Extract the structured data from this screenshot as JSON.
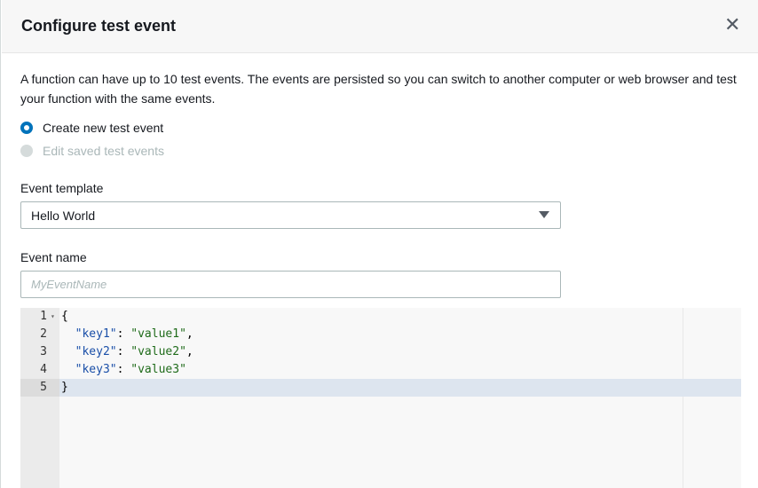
{
  "dialog": {
    "title": "Configure test event",
    "close_icon": "close-icon"
  },
  "description": "A function can have up to 10 test events. The events are persisted so you can switch to another computer or web browser and test your function with the same events.",
  "radios": [
    {
      "label": "Create new test event",
      "selected": true
    },
    {
      "label": "Edit saved test events",
      "selected": false,
      "disabled": true
    }
  ],
  "event_template": {
    "label": "Event template",
    "value": "Hello World"
  },
  "event_name": {
    "label": "Event name",
    "placeholder": "MyEventName",
    "value": ""
  },
  "editor": {
    "lines": [
      {
        "num": "1",
        "text": "{"
      },
      {
        "num": "2",
        "key": "\"key1\"",
        "value": "\"value1\"",
        "trail": ","
      },
      {
        "num": "3",
        "key": "\"key2\"",
        "value": "\"value2\"",
        "trail": ","
      },
      {
        "num": "4",
        "key": "\"key3\"",
        "value": "\"value3\"",
        "trail": ""
      },
      {
        "num": "5",
        "text": "}"
      }
    ],
    "active_line": 5
  },
  "colors": {
    "accent": "#0073bb",
    "key": "#1a4fa8",
    "string": "#1f6b1a"
  }
}
